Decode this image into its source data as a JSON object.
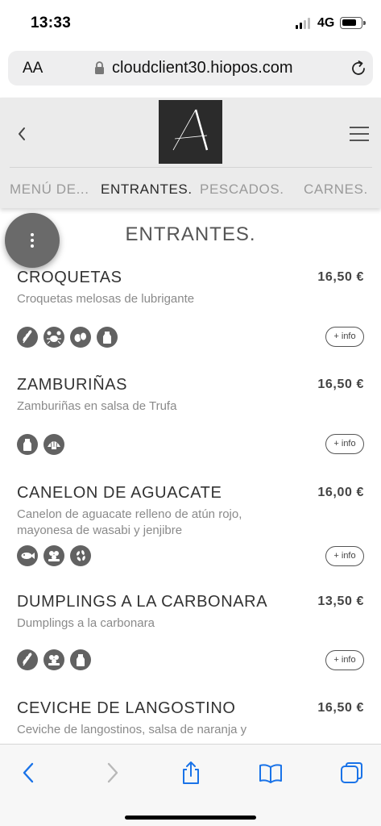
{
  "status_bar": {
    "time": "13:33",
    "network": "4G"
  },
  "browser": {
    "text_size_label": "AA",
    "url": "cloudclient30.hiopos.com"
  },
  "nav": {
    "tabs": [
      {
        "label": "MENÚ DE..."
      },
      {
        "label": "ENTRANTES."
      },
      {
        "label": "PESCADOS."
      },
      {
        "label": "CARNES."
      }
    ]
  },
  "section": {
    "title": "ENTRANTES."
  },
  "items": [
    {
      "name": "CROQUETAS",
      "price": "16,50 €",
      "description": "Croquetas melosas de lubrigante",
      "allergens": [
        "gluten-icon",
        "crustacean-icon",
        "egg-icon",
        "milk-icon"
      ],
      "info_label": "+ info"
    },
    {
      "name": "ZAMBURIÑAS",
      "price": "16,50 €",
      "description": "Zamburiñas en salsa de Trufa",
      "allergens": [
        "milk-icon",
        "mollusc-icon"
      ],
      "info_label": "+ info"
    },
    {
      "name": "CANELON DE AGUACATE",
      "price": "16,00 €",
      "description": "Canelon de aguacate relleno de atún rojo, mayonesa de wasabi y jenjibre",
      "allergens": [
        "fish-icon",
        "mustard-icon",
        "sesame-icon"
      ],
      "info_label": "+ info"
    },
    {
      "name": "DUMPLINGS A LA CARBONARA",
      "price": "13,50 €",
      "description": "Dumplings a la carbonara",
      "allergens": [
        "gluten-icon",
        "mustard-icon",
        "milk-icon"
      ],
      "info_label": "+ info"
    },
    {
      "name": "CEVICHE DE LANGOSTINO",
      "price": "16,50 €",
      "description": "Ceviche de langostinos, salsa de naranja y"
    }
  ],
  "colors": {
    "header_bg": "#ebebeb",
    "allergen_icon": "#626262",
    "ios_blue": "#1a73e8"
  }
}
